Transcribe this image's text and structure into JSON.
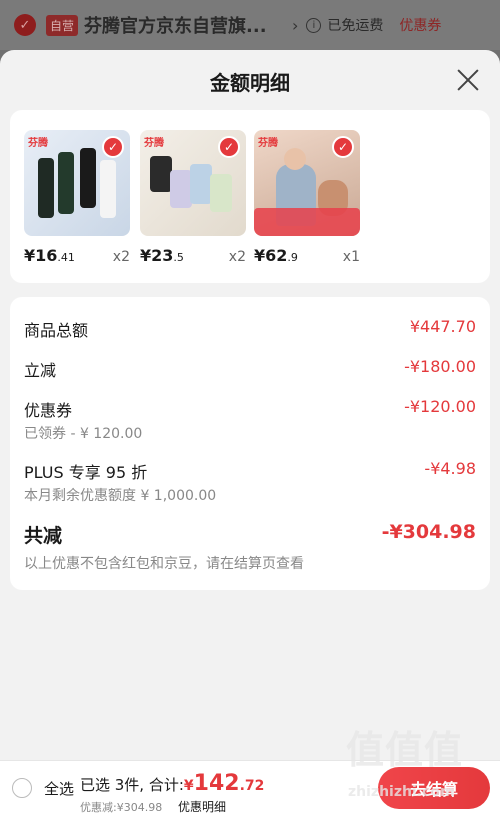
{
  "store_bar": {
    "badge": "自营",
    "name": "芬腾官方京东自营旗...",
    "arrow": "›",
    "info_icon": "i",
    "shipping": "已免运费",
    "coupon": "优惠券"
  },
  "sheet": {
    "title": "金额明细"
  },
  "products": [
    {
      "brand": "芬腾",
      "price_main": "¥16",
      "price_dec": ".41",
      "qty": "x2",
      "checked": true
    },
    {
      "brand": "芬腾",
      "price_main": "¥23",
      "price_dec": ".5",
      "qty": "x2",
      "checked": true
    },
    {
      "brand": "芬腾",
      "price_main": "¥62",
      "price_dec": ".9",
      "qty": "x1",
      "checked": true
    }
  ],
  "details": {
    "total_label": "商品总额",
    "total_value": "¥447.70",
    "instant_label": "立减",
    "instant_value": "-¥180.00",
    "coupon_label": "优惠券",
    "coupon_value": "-¥120.00",
    "coupon_sub": "已领券 - ¥ 120.00",
    "plus_label": "PLUS 专享 95 折",
    "plus_value": "-¥4.98",
    "plus_sub": "本月剩余优惠额度 ¥ 1,000.00",
    "reduce_label": "共减",
    "reduce_value": "-¥304.98",
    "reduce_sub": "以上优惠不包含红包和京豆，请在结算页查看"
  },
  "bottom_bar": {
    "select_all": "全选",
    "selected_text": "已选 3件, 合计:",
    "total_yen": "¥",
    "total_int": "142",
    "total_dec": ".72",
    "discount_line": "优惠减:¥304.98",
    "detail_link": "优惠明细",
    "checkout": "去结算"
  },
  "watermark": {
    "main": "值值值",
    "sub": "zhizhizhi.com"
  },
  "colors": {
    "accent": "#e4393c",
    "sheet_bg": "#f2f2f2",
    "overlay": "#6f6f6f"
  }
}
